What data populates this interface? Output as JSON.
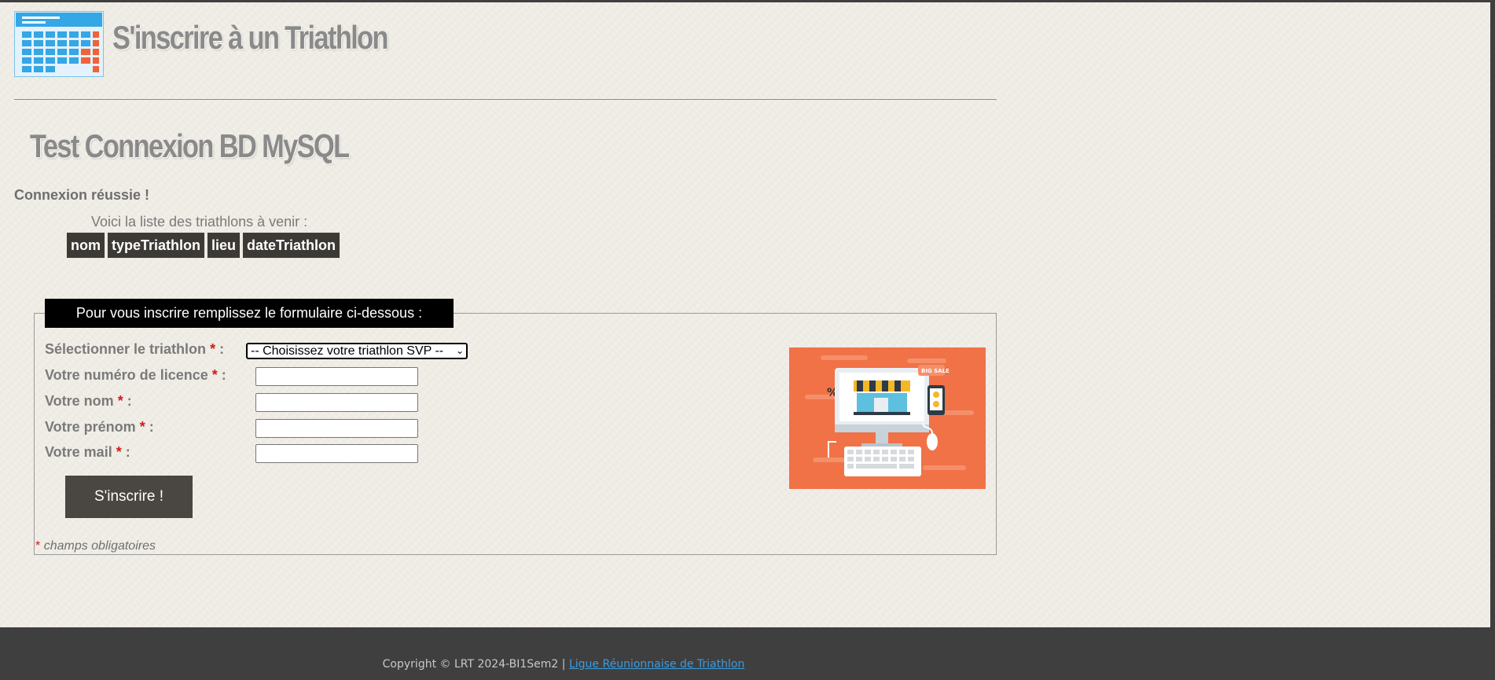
{
  "header": {
    "site_title": "S'inscrire à un Triathlon",
    "logo_icon": "calendar-icon"
  },
  "main": {
    "page_title": "Test Connexion BD MySQL",
    "connection_status": "Connexion réussie !",
    "list_intro": "Voici la liste des triathlons à venir :",
    "table": {
      "headers": [
        "nom",
        "typeTriathlon",
        "lieu",
        "dateTriathlon"
      ],
      "rows": []
    }
  },
  "form": {
    "legend": "Pour vous inscrire remplissez le formulaire ci-dessous :",
    "required_mark": "*",
    "fields": {
      "triathlon": {
        "label": "Sélectionner le triathlon",
        "suffix": " :",
        "value": "-- Choisissez votre triathlon SVP --"
      },
      "licence": {
        "label": "Votre numéro de licence",
        "suffix": " :",
        "value": ""
      },
      "nom": {
        "label": "Votre nom",
        "suffix": " :",
        "value": ""
      },
      "prenom": {
        "label": "Votre prénom",
        "suffix": " :",
        "value": ""
      },
      "mail": {
        "label": "Votre mail",
        "suffix": " :",
        "value": ""
      }
    },
    "submit_label": "S'inscrire !",
    "required_note": "champs obligatoires",
    "illustration": "online-shop-illustration"
  },
  "footer": {
    "copyright": "Copyright © LRT 2024-BI1Sem2 | ",
    "link_label": "Ligue Réunionnaise de Triathlon"
  },
  "colors": {
    "background": "#f1efe7",
    "footer": "#3f3f3f",
    "table_header": "#3d3a36",
    "required": "#d11a1a",
    "illustration_bg": "#f07246",
    "link": "#3a9be0"
  }
}
